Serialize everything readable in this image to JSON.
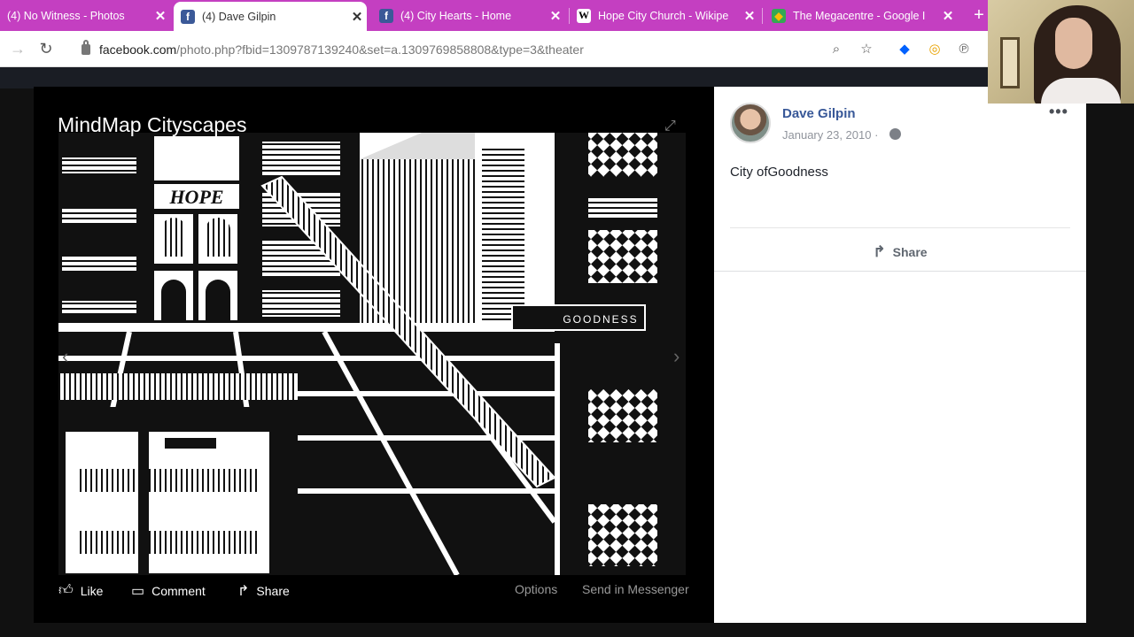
{
  "browser": {
    "tabs": [
      {
        "title": "(4) No Witness - Photos",
        "favicon": "photos-icon",
        "active": false
      },
      {
        "title": "(4) Dave Gilpin",
        "favicon": "facebook-icon",
        "active": true
      },
      {
        "title": "(4) City Hearts - Home",
        "favicon": "facebook-icon",
        "active": false
      },
      {
        "title": "Hope City Church - Wikipe",
        "favicon": "wikipedia-icon",
        "active": false
      },
      {
        "title": "The Megacentre - Google I",
        "favicon": "google-maps-icon",
        "active": false
      }
    ],
    "close_glyph": "✕",
    "new_tab_glyph": "+",
    "url_host": "facebook.com",
    "url_path": "/photo.php?fbid=1309787139240&set=a.1309769858808&type=3&theater",
    "accent": "#c43fc1"
  },
  "photo": {
    "caption": "MindMap Cityscapes",
    "sign_hope": "HOPE",
    "sign_goodness": "GOODNESS"
  },
  "actions": {
    "like": "Like",
    "comment": "Comment",
    "share": "Share",
    "options": "Options",
    "send": "Send in Messenger"
  },
  "post": {
    "author": "Dave Gilpin",
    "date": "January 23, 2010 ·",
    "text": "City ofGoodness",
    "share_label": "Share",
    "more_glyph": "•••"
  }
}
